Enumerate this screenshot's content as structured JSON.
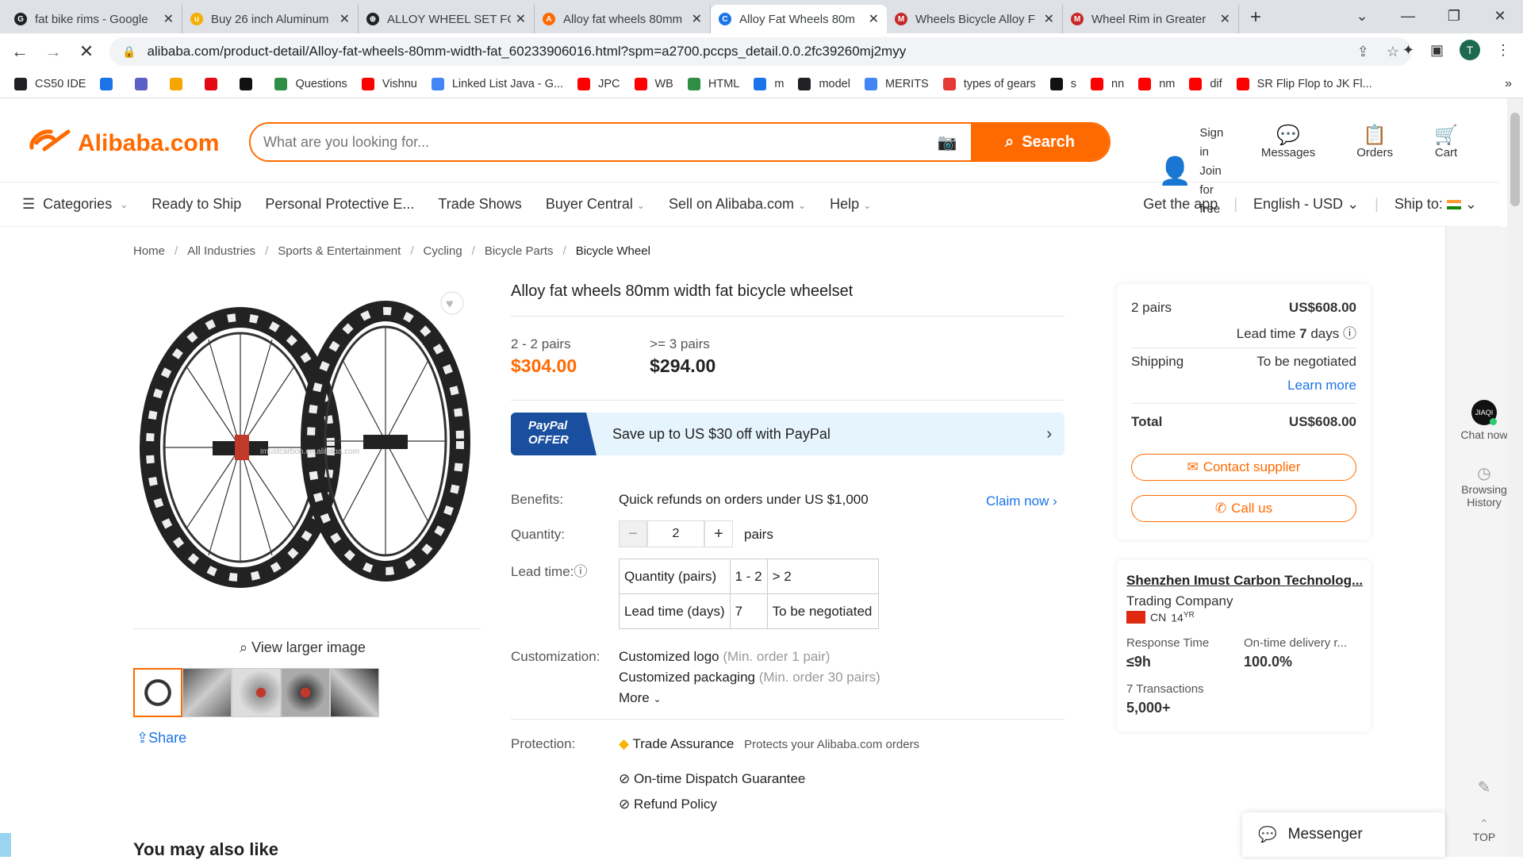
{
  "tabs": [
    {
      "title": "fat bike rims - Google",
      "color": "#202124",
      "icon": "G"
    },
    {
      "title": "Buy 26 inch Aluminum",
      "color": "#f5af02",
      "icon": "u"
    },
    {
      "title": "ALLOY WHEEL SET FO",
      "color": "#202124",
      "icon": "⊕"
    },
    {
      "title": "Alloy fat wheels 80mm",
      "color": "#ff6a00",
      "icon": "A"
    },
    {
      "title": "Alloy Fat Wheels 80m",
      "color": "#1a73e8",
      "icon": "C"
    },
    {
      "title": "Wheels Bicycle Alloy F",
      "color": "#c62828",
      "icon": "M"
    },
    {
      "title": "Wheel Rim in Greater",
      "color": "#c62828",
      "icon": "M"
    }
  ],
  "url": "alibaba.com/product-detail/Alloy-fat-wheels-80mm-width-fat_60233906016.html?spm=a2700.pccps_detail.0.0.2fc39260mj2myy",
  "avatar_letter": "T",
  "bookmarks": [
    {
      "label": "CS50 IDE",
      "color": "#202124"
    },
    {
      "label": "",
      "color": "#1a73e8"
    },
    {
      "label": "",
      "color": "#5b5fc7"
    },
    {
      "label": "",
      "color": "#f7a600"
    },
    {
      "label": "",
      "color": "#e50914"
    },
    {
      "label": "",
      "color": "#111"
    },
    {
      "label": "Questions",
      "color": "#2f8d46"
    },
    {
      "label": "Vishnu",
      "color": "#ff0000"
    },
    {
      "label": "Linked List Java - G...",
      "color": "#4285f4"
    },
    {
      "label": "JPC",
      "color": "#ff0000"
    },
    {
      "label": "WB",
      "color": "#ff0000"
    },
    {
      "label": "HTML",
      "color": "#2f8d46"
    },
    {
      "label": "m",
      "color": "#1a73e8"
    },
    {
      "label": "model",
      "color": "#202124"
    },
    {
      "label": "MERITS",
      "color": "#4285f4"
    },
    {
      "label": "types of gears",
      "color": "#e53935"
    },
    {
      "label": "s",
      "color": "#111"
    },
    {
      "label": "nn",
      "color": "#ff0000"
    },
    {
      "label": "nm",
      "color": "#ff0000"
    },
    {
      "label": "dif",
      "color": "#ff0000"
    },
    {
      "label": "SR Flip Flop to JK Fl...",
      "color": "#ff0000"
    }
  ],
  "header": {
    "logo": "Alibaba.com",
    "search_placeholder": "What are you looking for...",
    "search_button": "Search",
    "sign_in": "Sign in",
    "join": "Join for free",
    "messages": "Messages",
    "orders": "Orders",
    "cart": "Cart"
  },
  "catbar": {
    "categories": "Categories",
    "items": [
      "Ready to Ship",
      "Personal Protective E...",
      "Trade Shows",
      "Buyer Central",
      "Sell on Alibaba.com",
      "Help"
    ],
    "get_app": "Get the app",
    "language": "English - USD",
    "ship_to": "Ship to:"
  },
  "breadcrumb": [
    "Home",
    "All Industries",
    "Sports & Entertainment",
    "Cycling",
    "Bicycle Parts",
    "Bicycle Wheel"
  ],
  "product": {
    "title": "Alloy fat wheels 80mm width fat bicycle wheelset",
    "tier1_qty": "2 - 2 pairs",
    "tier1_price": "$304.00",
    "tier2_qty": ">= 3 pairs",
    "tier2_price": "$294.00",
    "paypal_badge_1": "PayPal",
    "paypal_badge_2": "OFFER",
    "paypal_text": "Save up to US $30 off with PayPal",
    "benefits_label": "Benefits:",
    "benefits_text": "Quick refunds on orders under US $1,000",
    "claim": "Claim now",
    "quantity_label": "Quantity:",
    "quantity": "2",
    "quantity_unit": "pairs",
    "leadtime_label": "Lead time:",
    "lt_h1": "Quantity (pairs)",
    "lt_h2": "1 - 2",
    "lt_h3": "> 2",
    "lt_r1": "Lead time (days)",
    "lt_r2": "7",
    "lt_r3": "To be negotiated",
    "custom_label": "Customization:",
    "custom1": "Customized logo",
    "custom1_min": "(Min. order 1 pair)",
    "custom2": "Customized packaging",
    "custom2_min": "(Min. order 30 pairs)",
    "more": "More",
    "protection_label": "Protection:",
    "trade_assurance": "Trade Assurance",
    "ta_sub": "Protects your Alibaba.com orders",
    "dispatch": "On-time Dispatch Guarantee",
    "refund": "Refund Policy",
    "view_larger": "View larger image",
    "share": "Share",
    "watermark": "imustcarbon.en.alibaba.com",
    "also_like": "You may also like"
  },
  "summary": {
    "pairs": "2 pairs",
    "price": "US$608.00",
    "lead_time_prefix": "Lead time ",
    "lead_time_days": "7",
    "lead_time_suffix": " days",
    "shipping": "Shipping",
    "shipping_val": "To be negotiated",
    "learn_more": "Learn more",
    "total": "Total",
    "total_val": "US$608.00",
    "contact": "Contact supplier",
    "call": "Call us"
  },
  "supplier": {
    "name": "Shenzhen Imust Carbon Technolog...",
    "type": "Trading Company",
    "country": "CN",
    "years": "14",
    "years_unit": "YR",
    "resp_label": "Response Time",
    "resp_val": "≤9h",
    "ontime_label": "On-time delivery r...",
    "ontime_val": "100.0%",
    "trans_label": "7 Transactions",
    "trans_val": "5,000+"
  },
  "sidebar": {
    "chat": "Chat now",
    "history": "Browsing History",
    "top": "TOP",
    "chat_badge": "JIAQI"
  },
  "messenger": "Messenger",
  "colors": {
    "accent": "#ff6a00",
    "link": "#1a73e8"
  }
}
